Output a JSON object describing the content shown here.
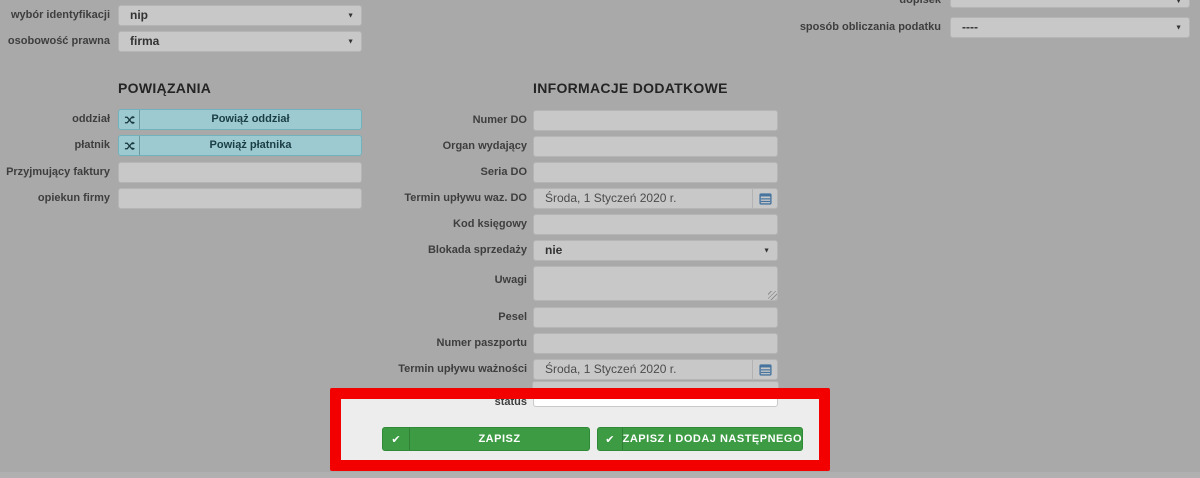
{
  "top_left": {
    "rows": [
      {
        "label": "wybór identyfikacji",
        "value": "nip"
      },
      {
        "label": "osobowość prawna",
        "value": "firma"
      }
    ]
  },
  "top_right": {
    "rows": [
      {
        "label": "dopisek",
        "value": ""
      },
      {
        "label": "sposób obliczania podatku",
        "value": "----"
      }
    ]
  },
  "powiazania": {
    "title": "POWIĄZANIA",
    "oddzial_label": "oddział",
    "oddzial_button": "Powiąż oddział",
    "platnik_label": "płatnik",
    "platnik_button": "Powiąż płatnika",
    "faktury_label": "Przyjmujący faktury",
    "opiekun_label": "opiekun firmy"
  },
  "informacje": {
    "title": "INFORMACJE DODATKOWE",
    "numer_do_label": "Numer DO",
    "organ_label": "Organ wydający",
    "seria_label": "Seria DO",
    "termin_waz_do_label": "Termin upływu waz. DO",
    "termin_waz_do_value": "Środa, 1 Styczeń 2020 r.",
    "kod_label": "Kod księgowy",
    "blokada_label": "Blokada sprzedaży",
    "blokada_value": "nie",
    "uwagi_label": "Uwagi",
    "pesel_label": "Pesel",
    "paszport_label": "Numer paszportu",
    "termin_waznosci_label": "Termin upływu ważności",
    "termin_waznosci_value": "Środa, 1 Styczeń 2020 r.",
    "status_label": "status",
    "status_value": ""
  },
  "actions": {
    "check": "✔",
    "save": "ZAPISZ",
    "save_and_next": "ZAPISZ I DODAJ NASTĘPNEGO"
  },
  "colors": {
    "page_dimmed_bg": "#a9a9a9",
    "highlight_bg": "#ededed",
    "highlight_border": "#f30000",
    "button_green": "#3d9b44",
    "button_teal": "#9dcad1"
  }
}
